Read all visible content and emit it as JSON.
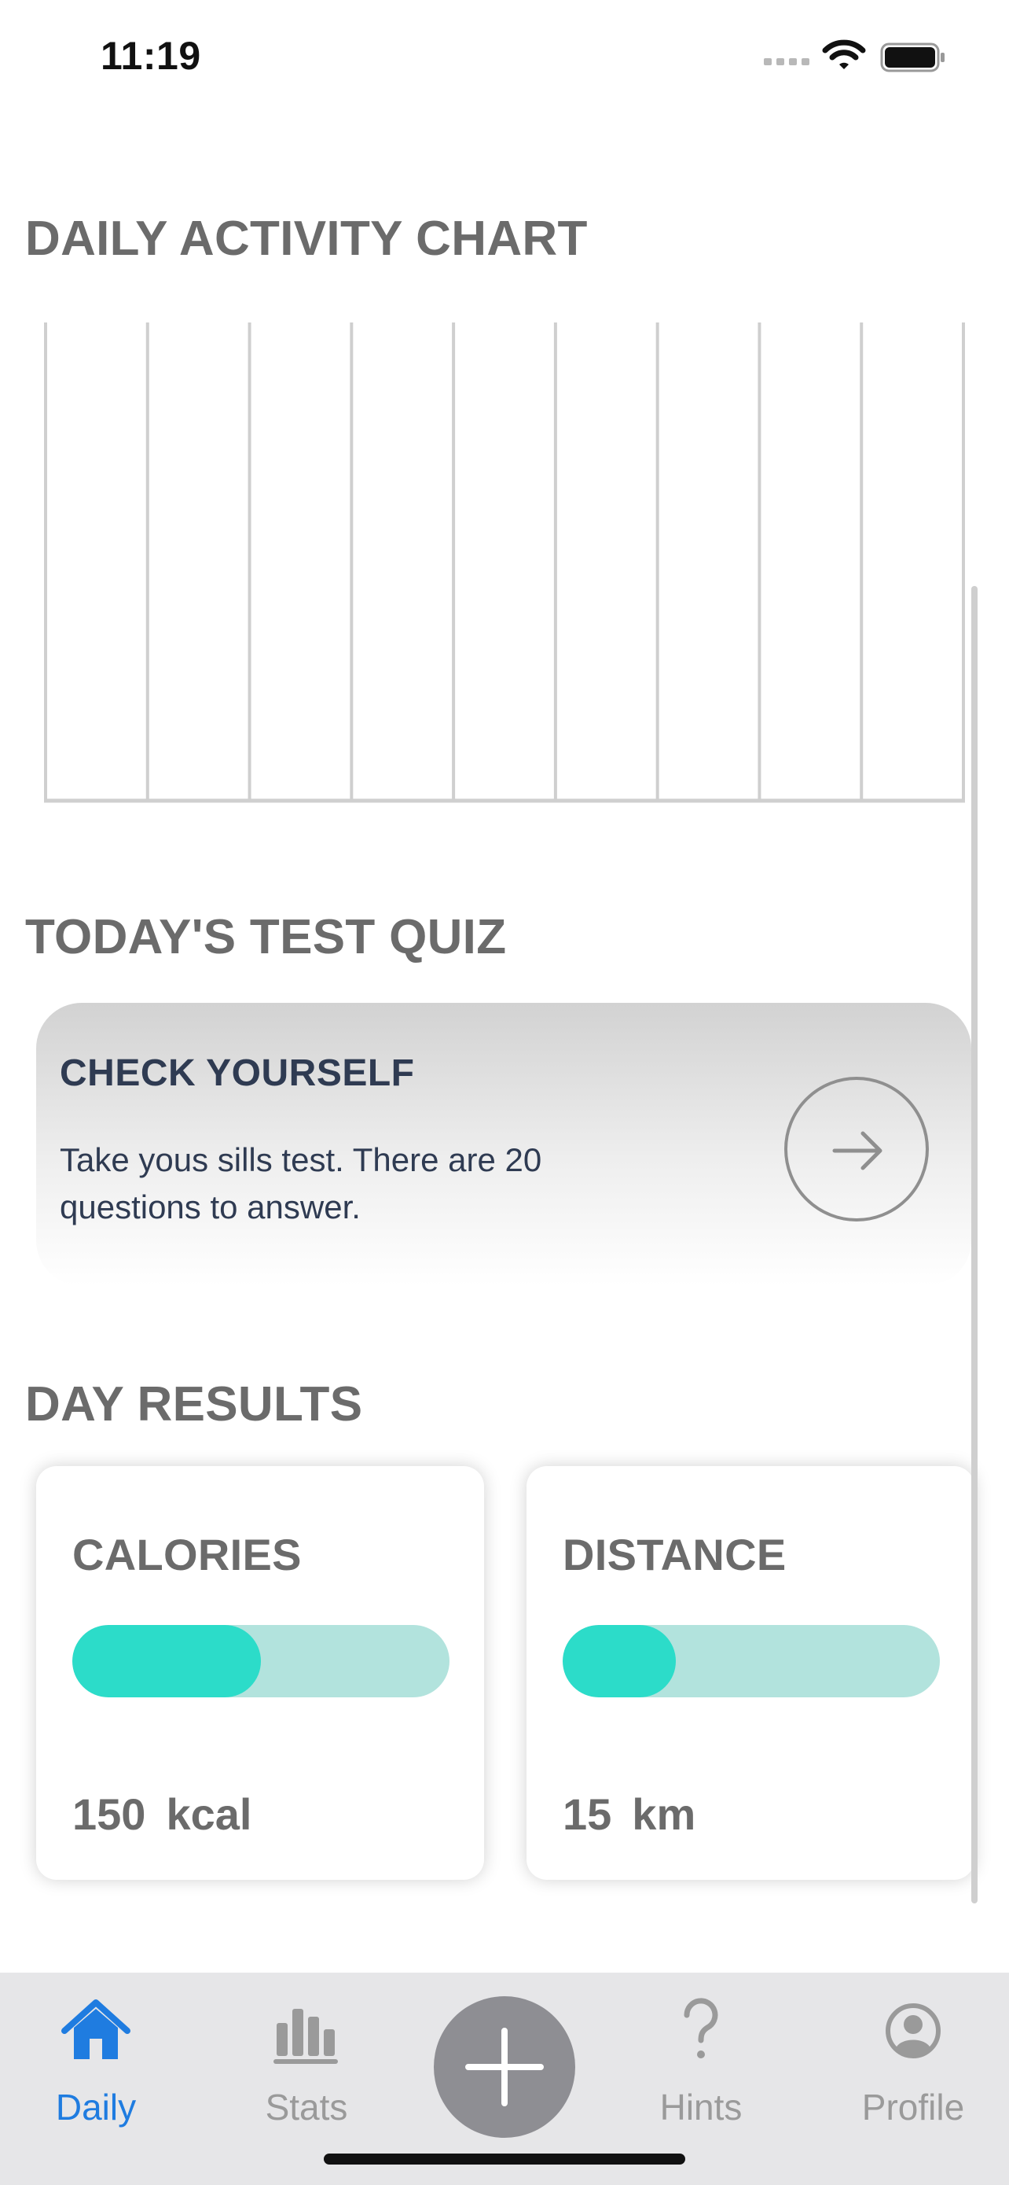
{
  "status_bar": {
    "time": "11:19"
  },
  "chart_section": {
    "title": "DAILY ACTIVITY CHART"
  },
  "chart_data": {
    "type": "bar",
    "title": "DAILY ACTIVITY CHART",
    "categories": [],
    "values": [],
    "grid": true,
    "gridline_count": 10
  },
  "quiz_section": {
    "title": "TODAY'S TEST QUIZ",
    "card_title": "CHECK YOURSELF",
    "card_text": "Take yous sills test. There are 20 questions to answer.",
    "arrow_icon": "arrow-right-icon"
  },
  "results_section": {
    "title": "DAY RESULTS",
    "cards": [
      {
        "label": "CALORIES",
        "value": "150",
        "unit": "kcal",
        "progress": 0.5
      },
      {
        "label": "DISTANCE",
        "value": "15",
        "unit": "km",
        "progress": 0.3
      }
    ]
  },
  "tab_bar": {
    "tabs": [
      {
        "label": "Daily",
        "icon": "house-icon",
        "active": true
      },
      {
        "label": "Stats",
        "icon": "bar-chart-icon",
        "active": false
      },
      {
        "label": "",
        "icon": "plus-icon",
        "active": false
      },
      {
        "label": "Hints",
        "icon": "question-icon",
        "active": false
      },
      {
        "label": "Profile",
        "icon": "profile-icon",
        "active": false
      }
    ]
  },
  "colors": {
    "accent_blue": "#1f7ce0",
    "progress_fill": "#2cdcc9",
    "progress_track": "#b2e3dd",
    "text_gray": "#6b6b6b",
    "quiz_text": "#2f3b52"
  }
}
